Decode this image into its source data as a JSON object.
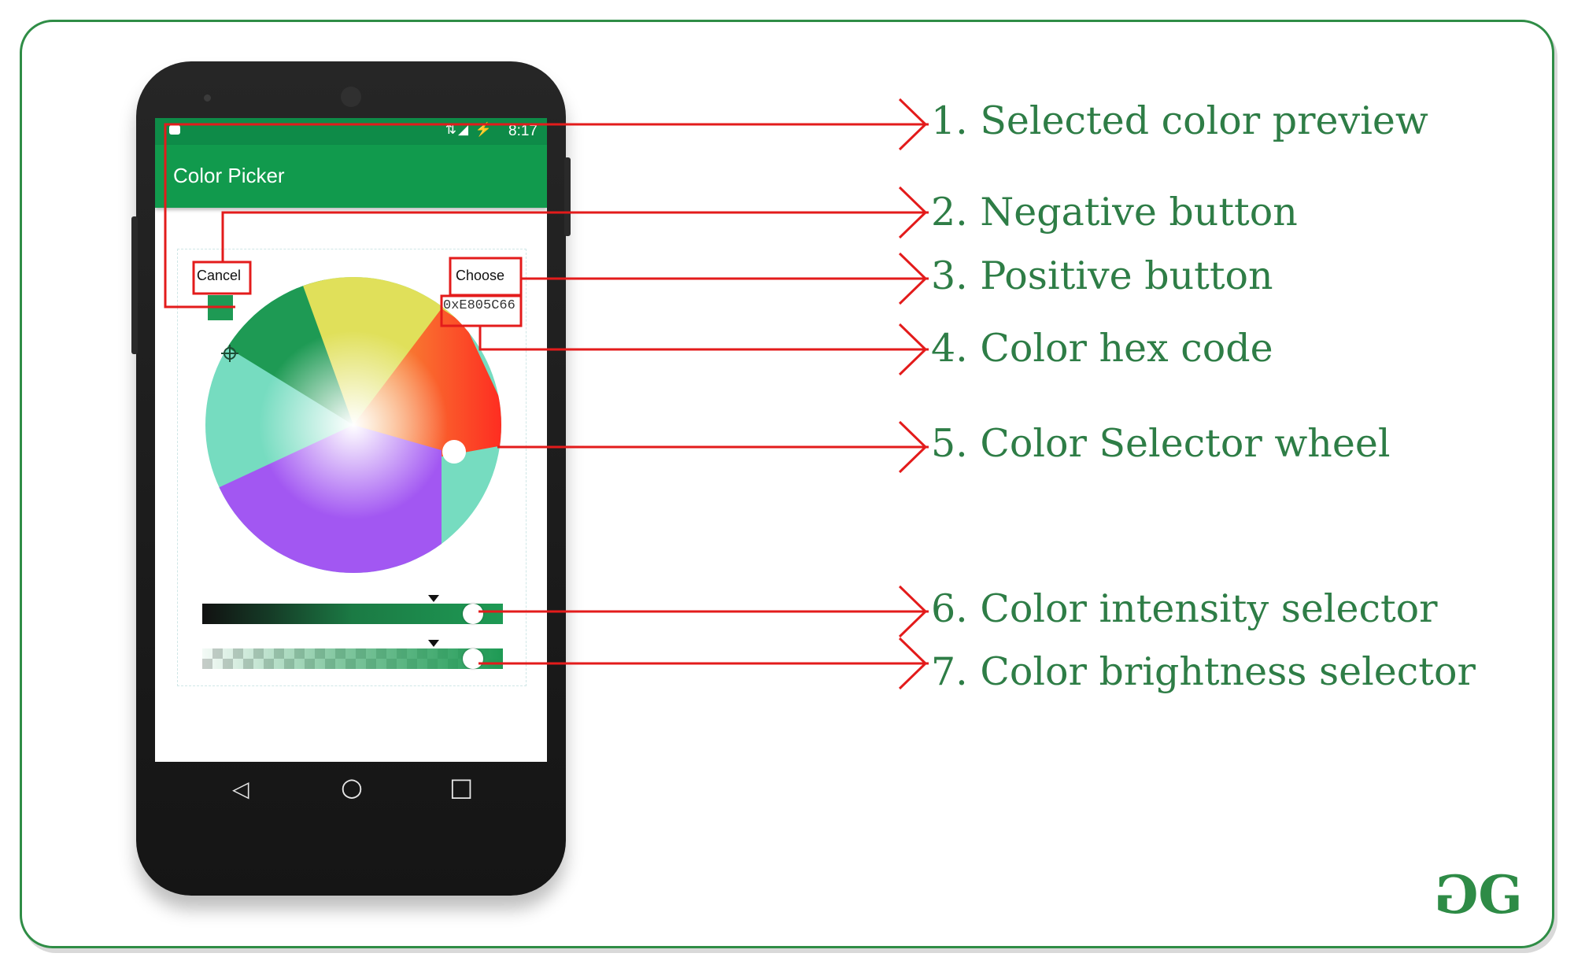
{
  "app": {
    "status_time": "8:17",
    "status_icons": "⇅◢ ⚡",
    "title": "Color Picker"
  },
  "dialog": {
    "cancel_label": "Cancel",
    "choose_label": "Choose",
    "hex_code": "0xE805C66",
    "selected_color": "#1e9a54"
  },
  "sliders": {
    "intensity_level": 0.9,
    "brightness_level": 0.9
  },
  "nav": {
    "back_glyph": "◁",
    "home_glyph": "○",
    "recents_glyph": "□"
  },
  "annotations": [
    "1. Selected color preview",
    "2. Negative button",
    "3. Positive button",
    "4. Color hex code",
    "5. Color Selector wheel",
    "6. Color intensity selector",
    "7. Color brightness selector"
  ],
  "logo": {
    "left": "G",
    "right": "G"
  },
  "colors": {
    "brand_green": "#2f8d46",
    "app_bar": "#119a4d",
    "annotation_red": "#e31b1b",
    "label_green": "#2e7d46"
  }
}
